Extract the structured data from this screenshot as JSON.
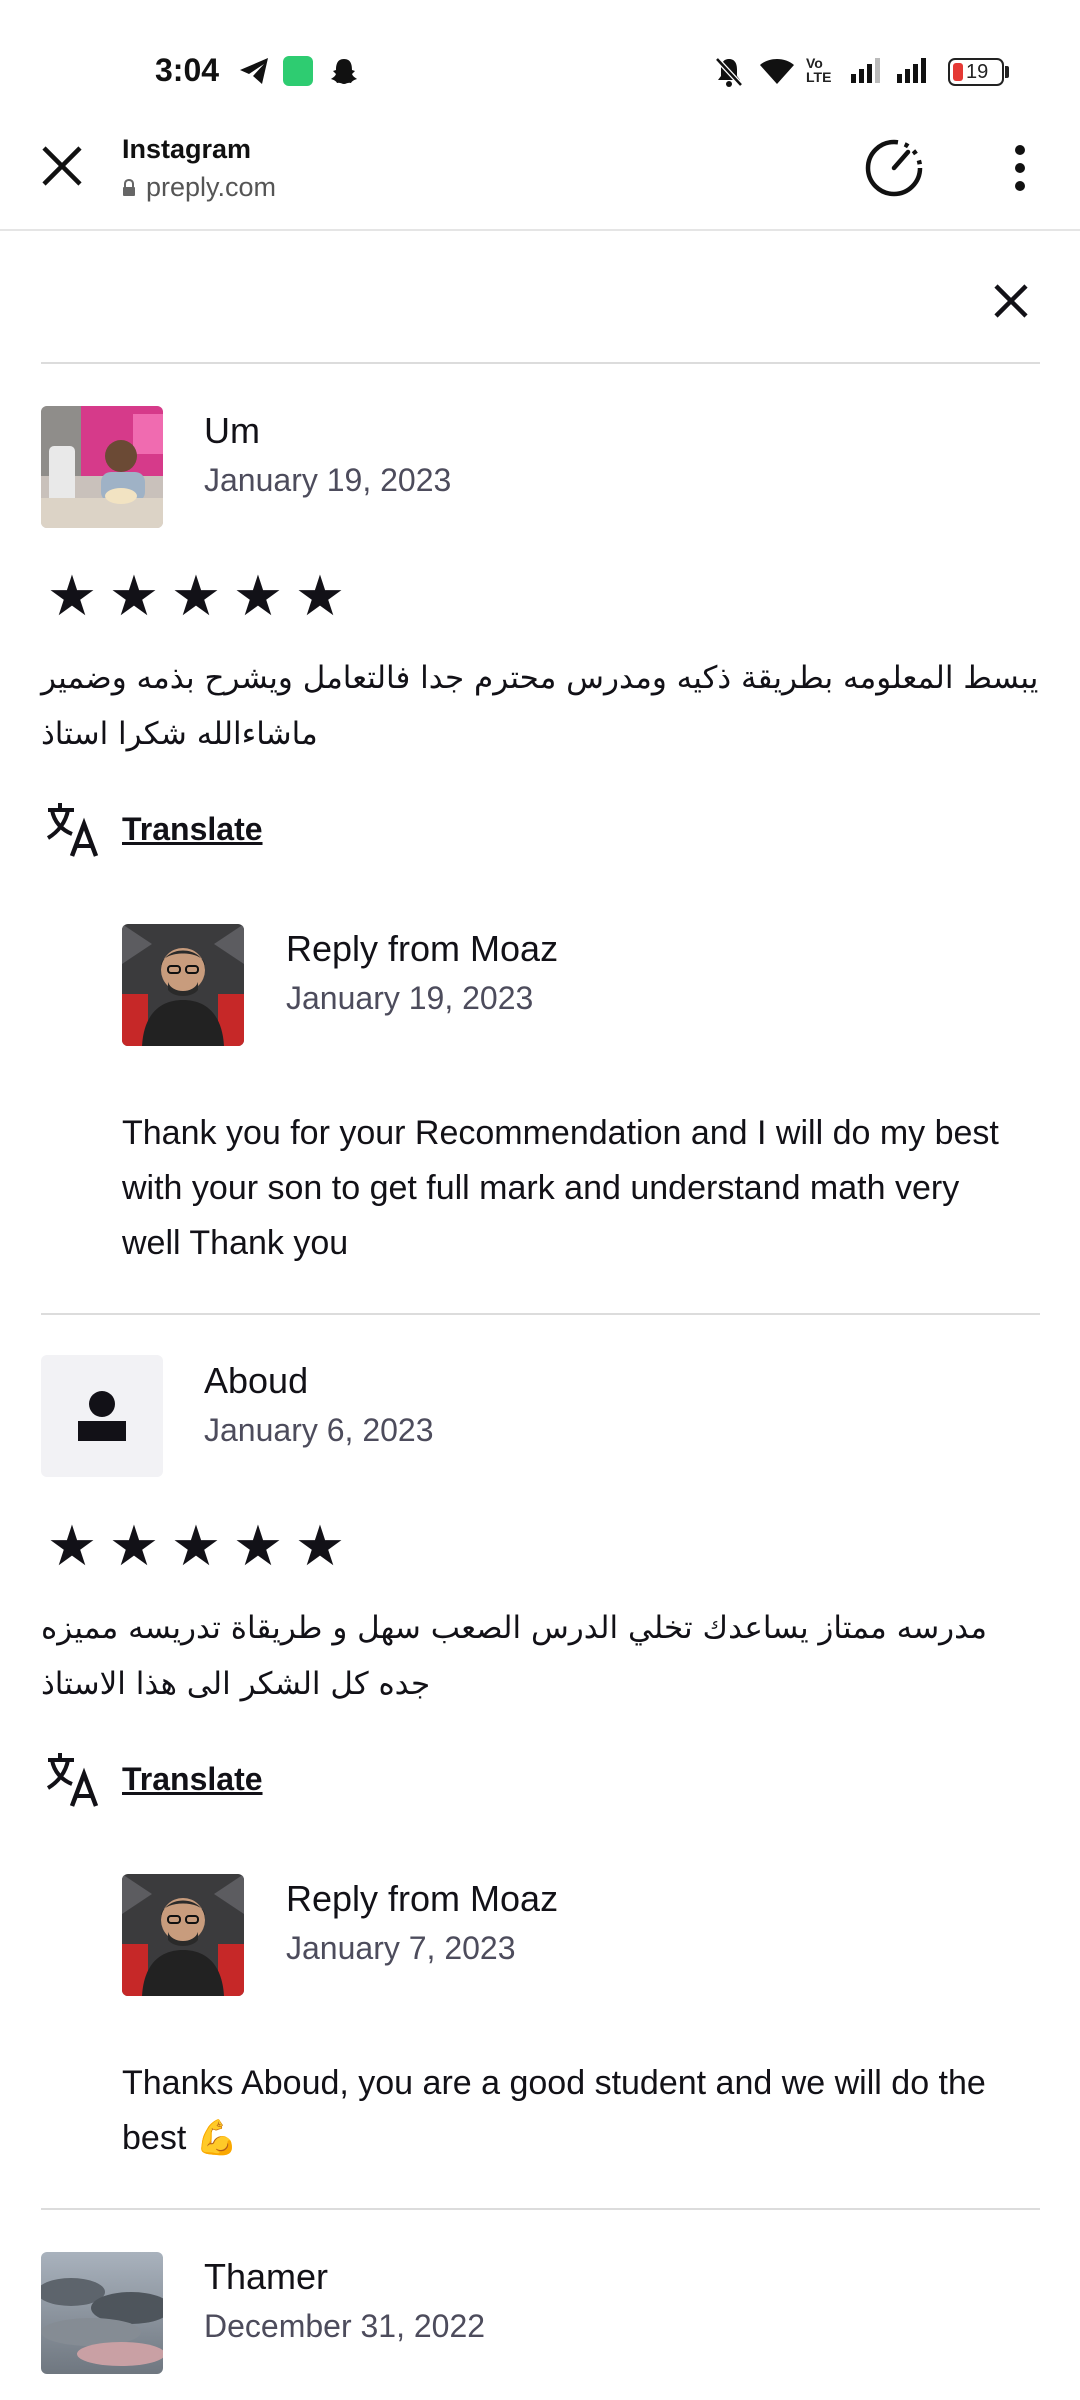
{
  "status_bar": {
    "time": "3:04",
    "battery": "19",
    "network_label": "VoLTE"
  },
  "browser": {
    "title": "Instagram",
    "url": "preply.com"
  },
  "reviews": [
    {
      "name": "Um",
      "date": "January 19, 2023",
      "rating": 5,
      "stars": "★★★★★",
      "text": "يبسط المعلومه بطريقة ذكيه ومدرس محترم جدا فالتعامل ويشرح بذمه وضمير ماشاءالله شكرا استاذ",
      "translate_label": "Translate",
      "reply": {
        "name": "Reply from Moaz",
        "date": "January 19, 2023",
        "text": "Thank you for your Recommendation and I will do my best with your son to get full mark and understand math very well Thank you"
      }
    },
    {
      "name": "Aboud",
      "date": "January 6, 2023",
      "rating": 5,
      "stars": "★★★★★",
      "text": "مدرسه ممتاز يساعدك تخلي الدرس الصعب سهل و طريقاة تدريسه مميزه جده كل الشكر الى هذا الاستاذ",
      "translate_label": "Translate",
      "reply": {
        "name": "Reply from Moaz",
        "date": "January 7, 2023",
        "text": "Thanks Aboud, you are a good student and we will do the best",
        "emoji": "💪"
      }
    },
    {
      "name": "Thamer",
      "date": "December 31, 2022"
    }
  ],
  "colors": {
    "text": "#121117",
    "muted": "#4d4c5c",
    "divider": "#dcdcdc"
  }
}
